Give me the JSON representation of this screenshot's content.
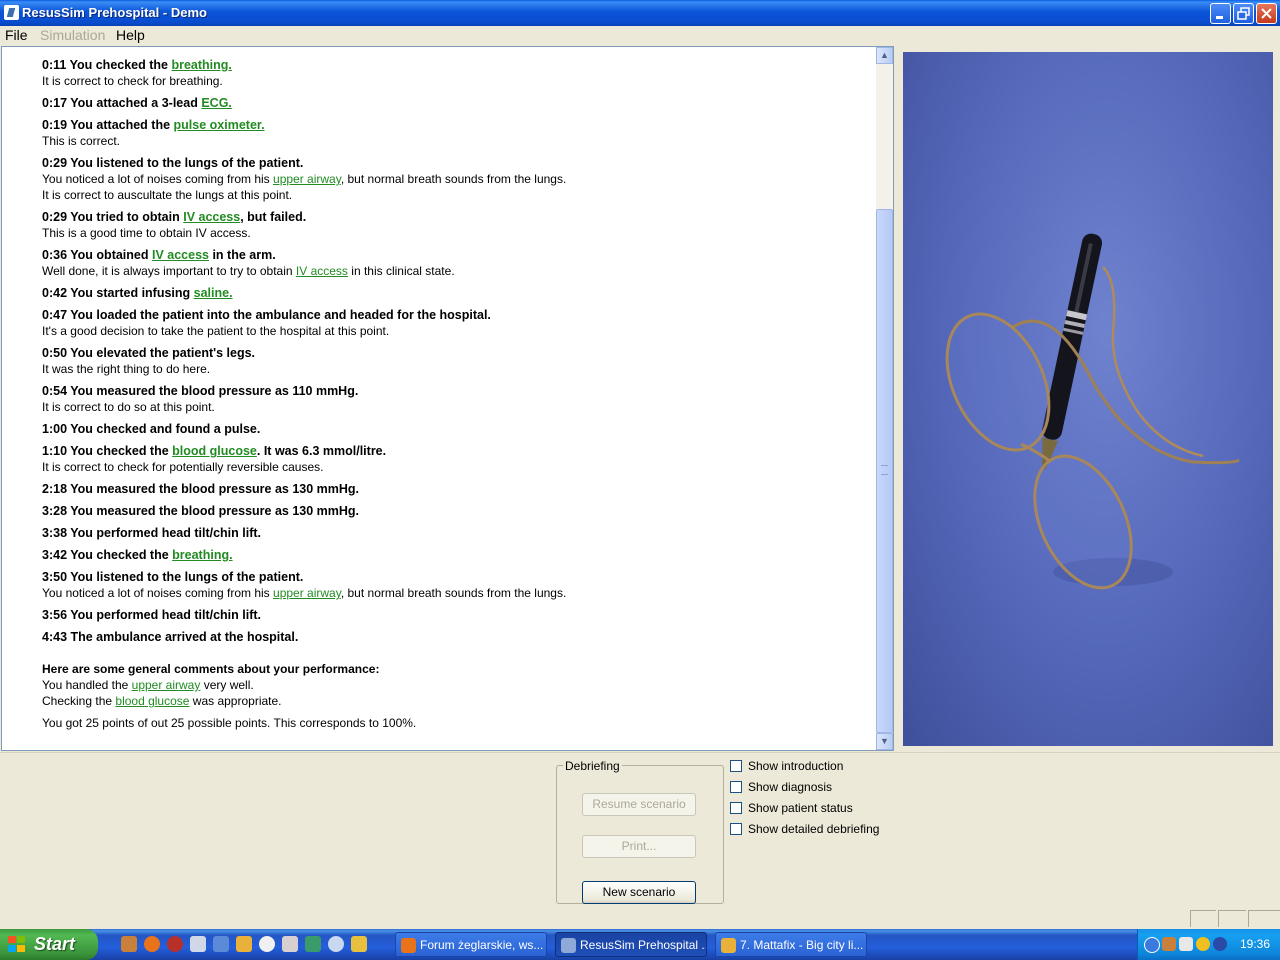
{
  "window": {
    "title": "ResusSim Prehospital - Demo"
  },
  "menu": {
    "file": "File",
    "simulation": "Simulation",
    "help": "Help"
  },
  "log": {
    "entries": [
      {
        "head": [
          {
            "t": "0:11 You checked the "
          },
          {
            "t": "breathing.",
            "link": true
          }
        ],
        "sub": [
          "It is correct to check for breathing."
        ]
      },
      {
        "head": [
          {
            "t": "0:17 You attached a 3-lead "
          },
          {
            "t": "ECG.",
            "link": true
          }
        ],
        "sub": []
      },
      {
        "head": [
          {
            "t": "0:19 You attached the "
          },
          {
            "t": "pulse oximeter.",
            "link": true
          }
        ],
        "sub": [
          "This is correct."
        ]
      },
      {
        "head": [
          {
            "t": "0:29 You listened to the lungs of the patient."
          }
        ],
        "sub": [
          [
            {
              "t": "You noticed a lot of noises coming from his "
            },
            {
              "t": "upper airway",
              "link": true
            },
            {
              "t": ", but normal breath sounds from the lungs."
            }
          ],
          "It is correct to auscultate the lungs at this point."
        ]
      },
      {
        "head": [
          {
            "t": "0:29 You tried to obtain "
          },
          {
            "t": "IV access",
            "link": true
          },
          {
            "t": ", but failed."
          }
        ],
        "sub": [
          "This is a good time to obtain IV access."
        ]
      },
      {
        "head": [
          {
            "t": "0:36 You obtained "
          },
          {
            "t": "IV access",
            "link": true
          },
          {
            "t": " in the arm."
          }
        ],
        "sub": [
          [
            {
              "t": "Well done, it is always important to try to obtain "
            },
            {
              "t": "IV access",
              "link": true
            },
            {
              "t": " in this clinical state."
            }
          ]
        ]
      },
      {
        "head": [
          {
            "t": "0:42 You started infusing "
          },
          {
            "t": "saline.",
            "link": true
          }
        ],
        "sub": []
      },
      {
        "head": [
          {
            "t": "0:47 You loaded the patient into the ambulance and headed for the hospital."
          }
        ],
        "sub": [
          "It's a good decision to take the patient to the hospital at this point."
        ]
      },
      {
        "head": [
          {
            "t": "0:50 You elevated the patient's legs."
          }
        ],
        "sub": [
          "It was the right thing to do here."
        ]
      },
      {
        "head": [
          {
            "t": "0:54 You measured the blood pressure as 110 mmHg."
          }
        ],
        "sub": [
          "It is correct to do so at this point."
        ]
      },
      {
        "head": [
          {
            "t": "1:00 You checked and found a pulse."
          }
        ],
        "sub": []
      },
      {
        "head": [
          {
            "t": "1:10 You checked the "
          },
          {
            "t": "blood glucose",
            "link": true
          },
          {
            "t": ". It was 6.3 mmol/litre."
          }
        ],
        "sub": [
          "It is correct to check for potentially reversible causes."
        ]
      },
      {
        "head": [
          {
            "t": "2:18 You measured the blood pressure as 130 mmHg."
          }
        ],
        "sub": []
      },
      {
        "head": [
          {
            "t": "3:28 You measured the blood pressure as 130 mmHg."
          }
        ],
        "sub": []
      },
      {
        "head": [
          {
            "t": "3:38 You performed head tilt/chin lift."
          }
        ],
        "sub": []
      },
      {
        "head": [
          {
            "t": "3:42 You checked the "
          },
          {
            "t": "breathing.",
            "link": true
          }
        ],
        "sub": []
      },
      {
        "head": [
          {
            "t": "3:50 You listened to the lungs of the patient."
          }
        ],
        "sub": [
          [
            {
              "t": "You noticed a lot of noises coming from his "
            },
            {
              "t": "upper airway",
              "link": true
            },
            {
              "t": ", but normal breath sounds from the lungs."
            }
          ]
        ]
      },
      {
        "head": [
          {
            "t": "3:56 You performed head tilt/chin lift."
          }
        ],
        "sub": []
      },
      {
        "head": [
          {
            "t": "4:43 The ambulance arrived at the hospital."
          }
        ],
        "sub": []
      }
    ],
    "comments_heading": "Here are some general comments about your performance:",
    "comments": [
      [
        {
          "t": "You handled the "
        },
        {
          "t": "upper airway",
          "link": true
        },
        {
          "t": " very well."
        }
      ],
      [
        {
          "t": "Checking the "
        },
        {
          "t": "blood glucose",
          "link": true
        },
        {
          "t": " was appropriate."
        }
      ]
    ],
    "score_text": "You got 25 points of out 25 possible points. This corresponds to 100%."
  },
  "debriefing": {
    "legend": "Debriefing",
    "resume_label": "Resume scenario",
    "print_label": "Print...",
    "new_label": "New scenario"
  },
  "checkboxes": [
    {
      "label": "Show introduction",
      "checked": false
    },
    {
      "label": "Show diagnosis",
      "checked": false
    },
    {
      "label": "Show patient status",
      "checked": false
    },
    {
      "label": "Show detailed debriefing",
      "checked": false
    }
  ],
  "taskbar": {
    "start_label": "Start",
    "tasks": [
      {
        "label": "Forum żeglarskie, ws...",
        "icon_color": "#e8731a"
      },
      {
        "label": "ResusSim Prehospital ...",
        "icon_color": "#8fa9d8"
      },
      {
        "label": "7. Mattafix - Big city li...",
        "icon_color": "#e9b13a"
      }
    ],
    "clock": "19:36"
  }
}
